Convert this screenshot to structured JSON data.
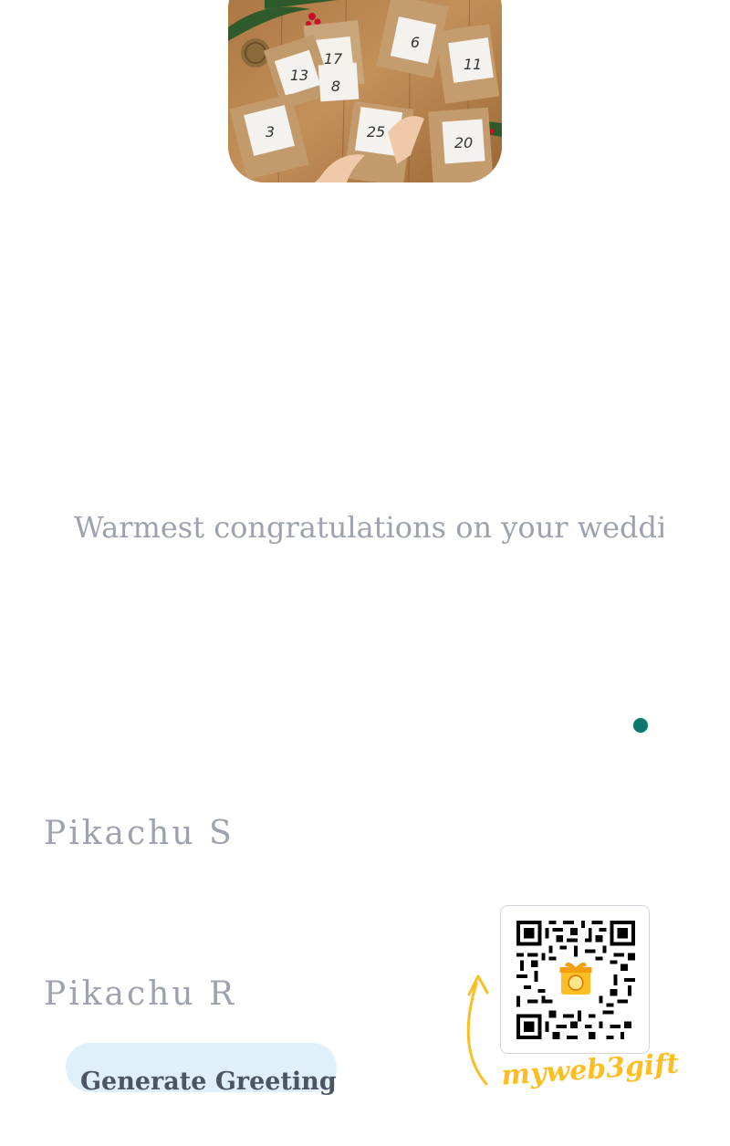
{
  "greeting": {
    "message": "Warmest congratulations on your wedding"
  },
  "names": {
    "sender": "Pikachu S",
    "recipient": "Pikachu R"
  },
  "actions": {
    "generate_label": "Generate Greeting"
  },
  "brand": {
    "name": "myweb3gift",
    "color": "#fbbf24"
  },
  "hero_image": {
    "tag_numbers": [
      "17",
      "13",
      "8",
      "6",
      "11",
      "3",
      "25",
      "20"
    ]
  },
  "colors": {
    "text_muted": "#9ca3af",
    "button_bg": "#dff0fb",
    "button_text": "#4b5563",
    "dot": "#0f766e"
  },
  "icons": {
    "qr": "qr-code-icon",
    "arrow": "curved-arrow-icon",
    "gift": "gift-icon",
    "dot": "status-dot-icon"
  }
}
